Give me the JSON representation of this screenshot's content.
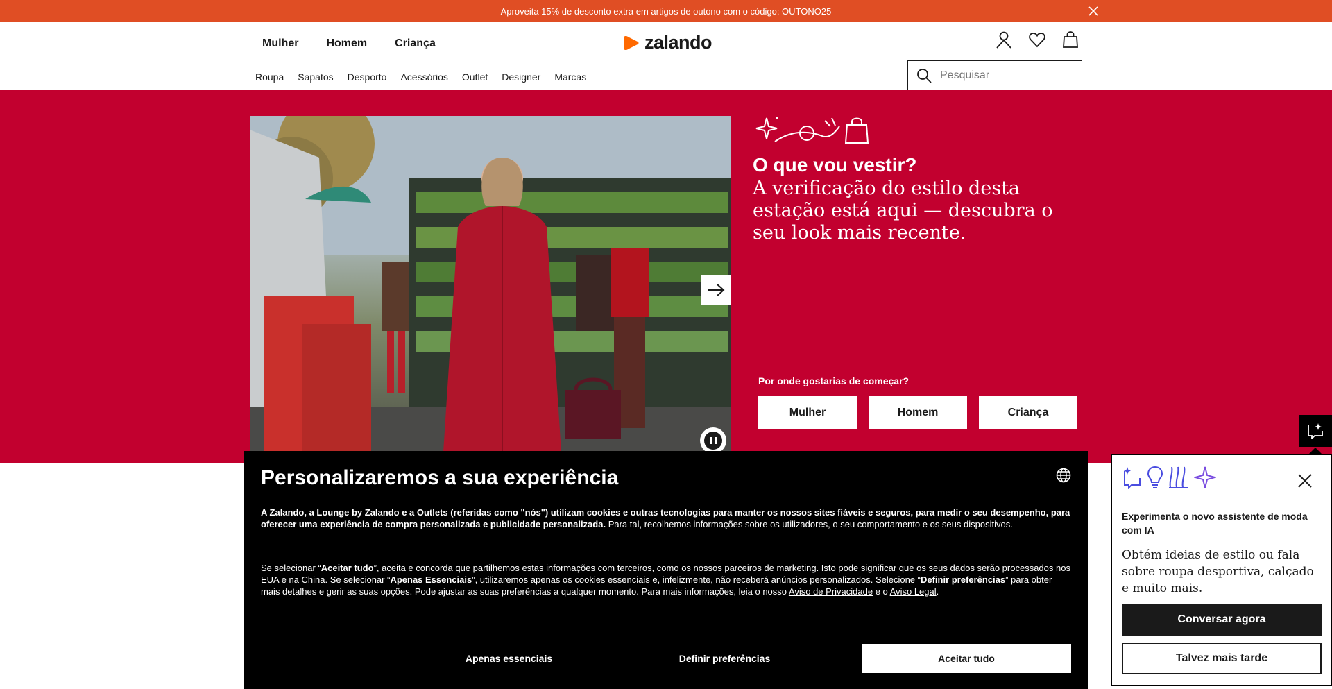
{
  "promo": {
    "text": "Aproveita 15% de desconto extra em artigos de outono com o código: OUTONO25"
  },
  "header": {
    "gender_tabs": [
      "Mulher",
      "Homem",
      "Criança"
    ],
    "logo_text": "zalando",
    "categories": [
      "Roupa",
      "Sapatos",
      "Desporto",
      "Acessórios",
      "Outlet",
      "Designer",
      "Marcas"
    ],
    "search_placeholder": "Pesquisar",
    "icons": [
      "account-icon",
      "wishlist-heart-icon",
      "shopping-bag-icon"
    ]
  },
  "hero": {
    "title": "O que vou vestir?",
    "subtitle": "A verificação do estilo desta estação está aqui — descubra o seu look mais recente.",
    "ask": "Por onde gostarias de começar?",
    "buttons": [
      "Mulher",
      "Homem",
      "Criança"
    ],
    "bg_color": "#c2002f"
  },
  "cookie": {
    "title": "Personalizaremos a sua experiência",
    "p1_bold": "A Zalando, a Lounge by Zalando e a Outlets (referidas como \"nós\") utilizam cookies e outras tecnologias para manter os nossos sites fiáveis e seguros, para medir o seu desempenho, para oferecer uma experiência de compra personalizada e publicidade personalizada.",
    "p1_rest": " Para tal, recolhemos informações sobre os utilizadores, o seu comportamento e os seus dispositivos.",
    "p2_a": "Se selecionar “",
    "p2_b": "Aceitar tudo",
    "p2_c": "”, aceita e concorda que partilhemos estas informações com terceiros, como os nossos parceiros de marketing. Isto pode significar que os seus dados serão processados nos EUA e na China. Se selecionar “",
    "p2_d": "Apenas Essenciais",
    "p2_e": "”, utilizaremos apenas os cookies essenciais e, infelizmente, não receberá anúncios personalizados. Selecione “",
    "p2_f": "Definir preferências",
    "p2_g": "” para obter mais detalhes e gerir as suas opções. Pode ajustar as suas preferências a qualquer momento. Para mais informações, leia o nosso ",
    "privacy_link": "Aviso de Privacidade",
    "p2_h": " e o ",
    "legal_link": "Aviso Legal",
    "p2_i": ".",
    "btn_essential": "Apenas essenciais",
    "btn_prefs": "Definir preferências",
    "btn_accept": "Aceitar tudo"
  },
  "assistant": {
    "heading": "Experimenta o novo assistente de moda com IA",
    "text": "Obtém ideias de estilo ou fala sobre roupa desportiva, calçado e muito mais.",
    "btn_chat": "Conversar agora",
    "btn_later": "Talvez mais tarde",
    "accent_color": "#4a4de0"
  },
  "colors": {
    "promo": "#e04e24",
    "brand_orange": "#ff6900",
    "hero": "#c2002f"
  }
}
